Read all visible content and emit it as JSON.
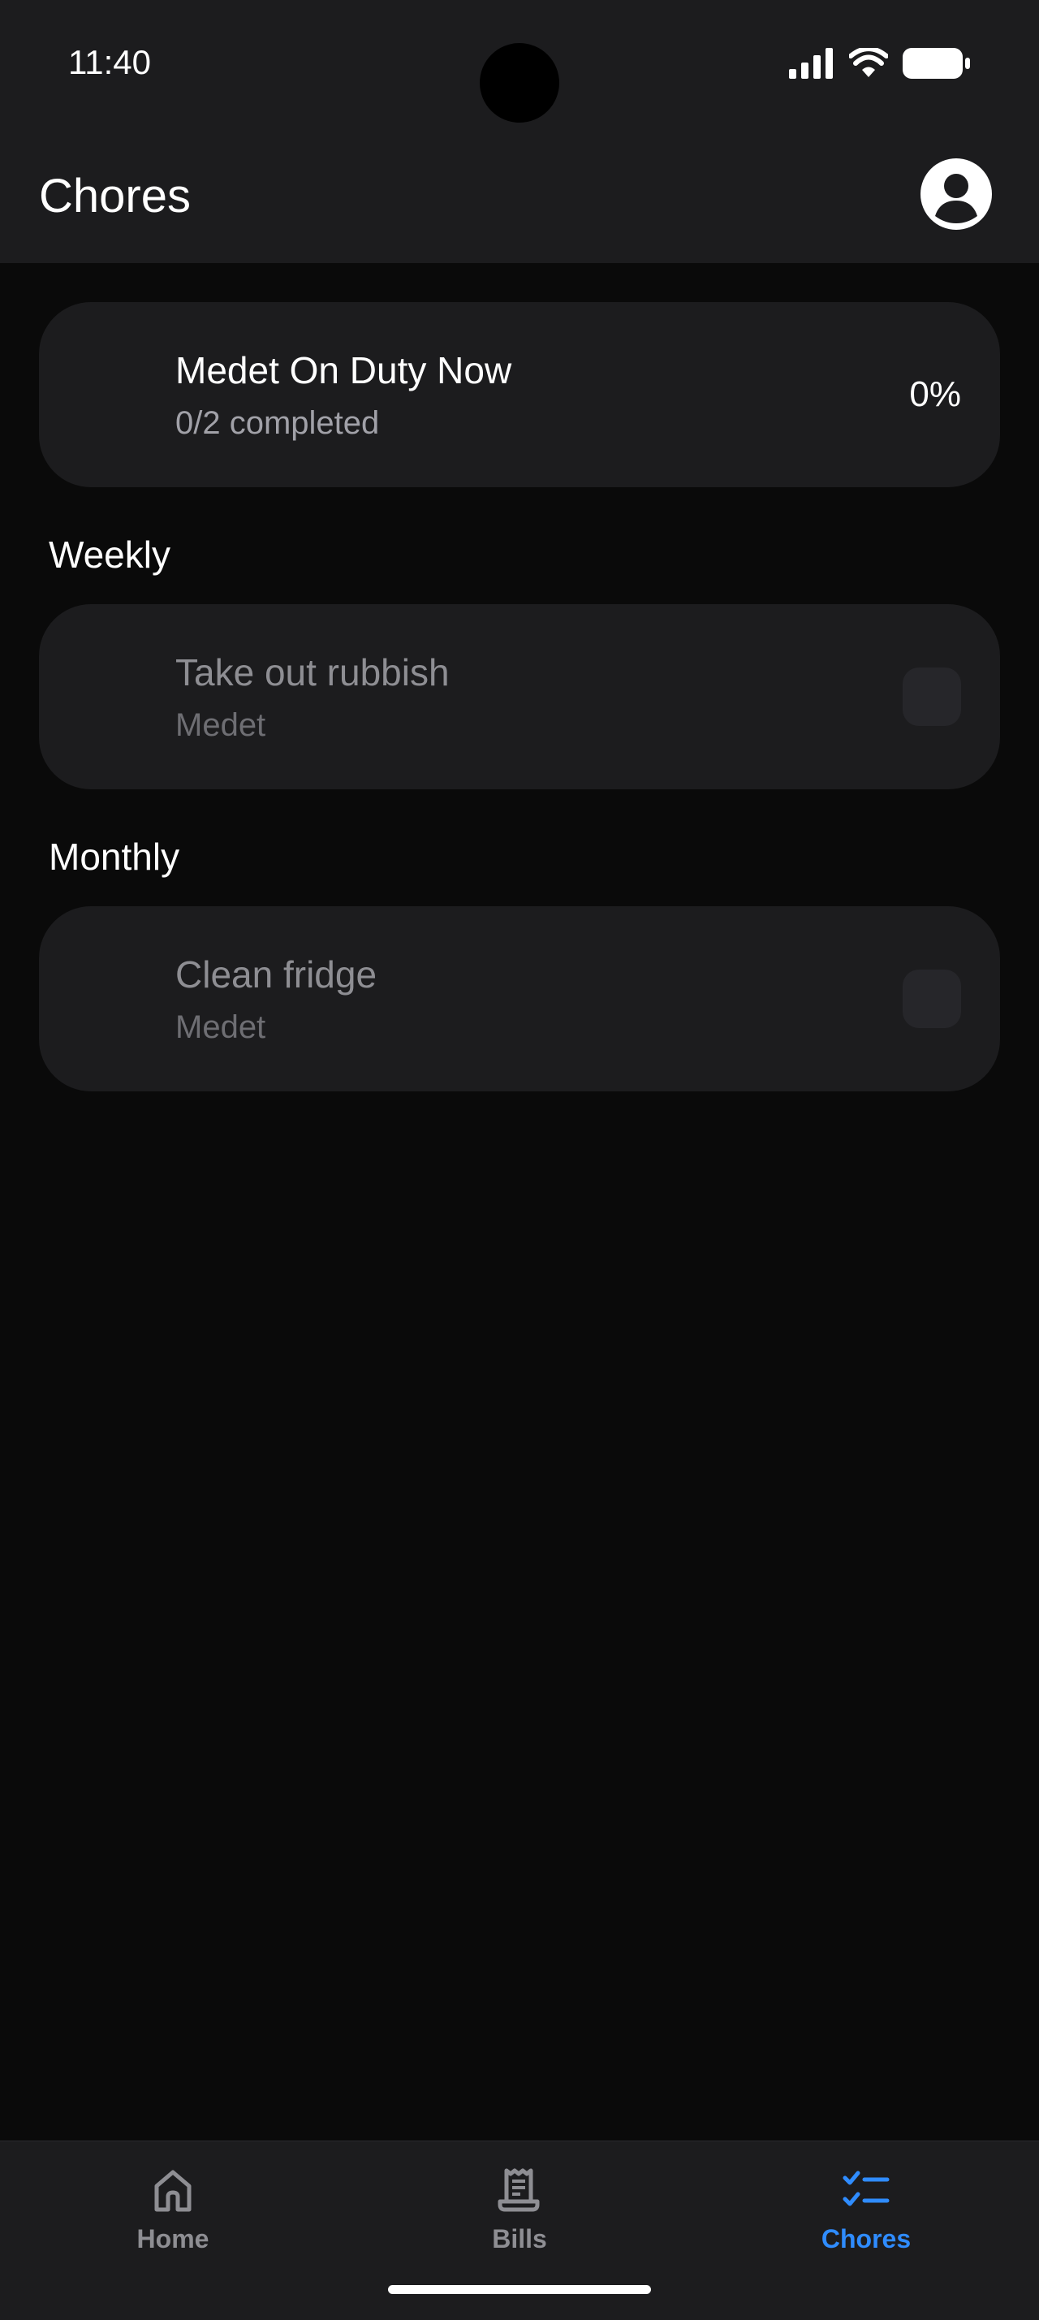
{
  "status_bar": {
    "time": "11:40"
  },
  "header": {
    "title": "Chores"
  },
  "duty_card": {
    "title": "Medet On Duty Now",
    "subtitle": "0/2 completed",
    "percent": "0%"
  },
  "sections": [
    {
      "label": "Weekly",
      "chores": [
        {
          "title": "Take out rubbish",
          "assignee": "Medet",
          "done": false
        }
      ]
    },
    {
      "label": "Monthly",
      "chores": [
        {
          "title": "Clean fridge",
          "assignee": "Medet",
          "done": false
        }
      ]
    }
  ],
  "bottom_nav": {
    "items": [
      {
        "label": "Home",
        "icon": "home-icon",
        "active": false
      },
      {
        "label": "Bills",
        "icon": "receipt-icon",
        "active": false
      },
      {
        "label": "Chores",
        "icon": "checklist-icon",
        "active": true
      }
    ]
  },
  "colors": {
    "background": "#0a0a0a",
    "surface": "#1c1c1e",
    "accent": "#2f8cff",
    "muted_text": "#8e8e93"
  }
}
